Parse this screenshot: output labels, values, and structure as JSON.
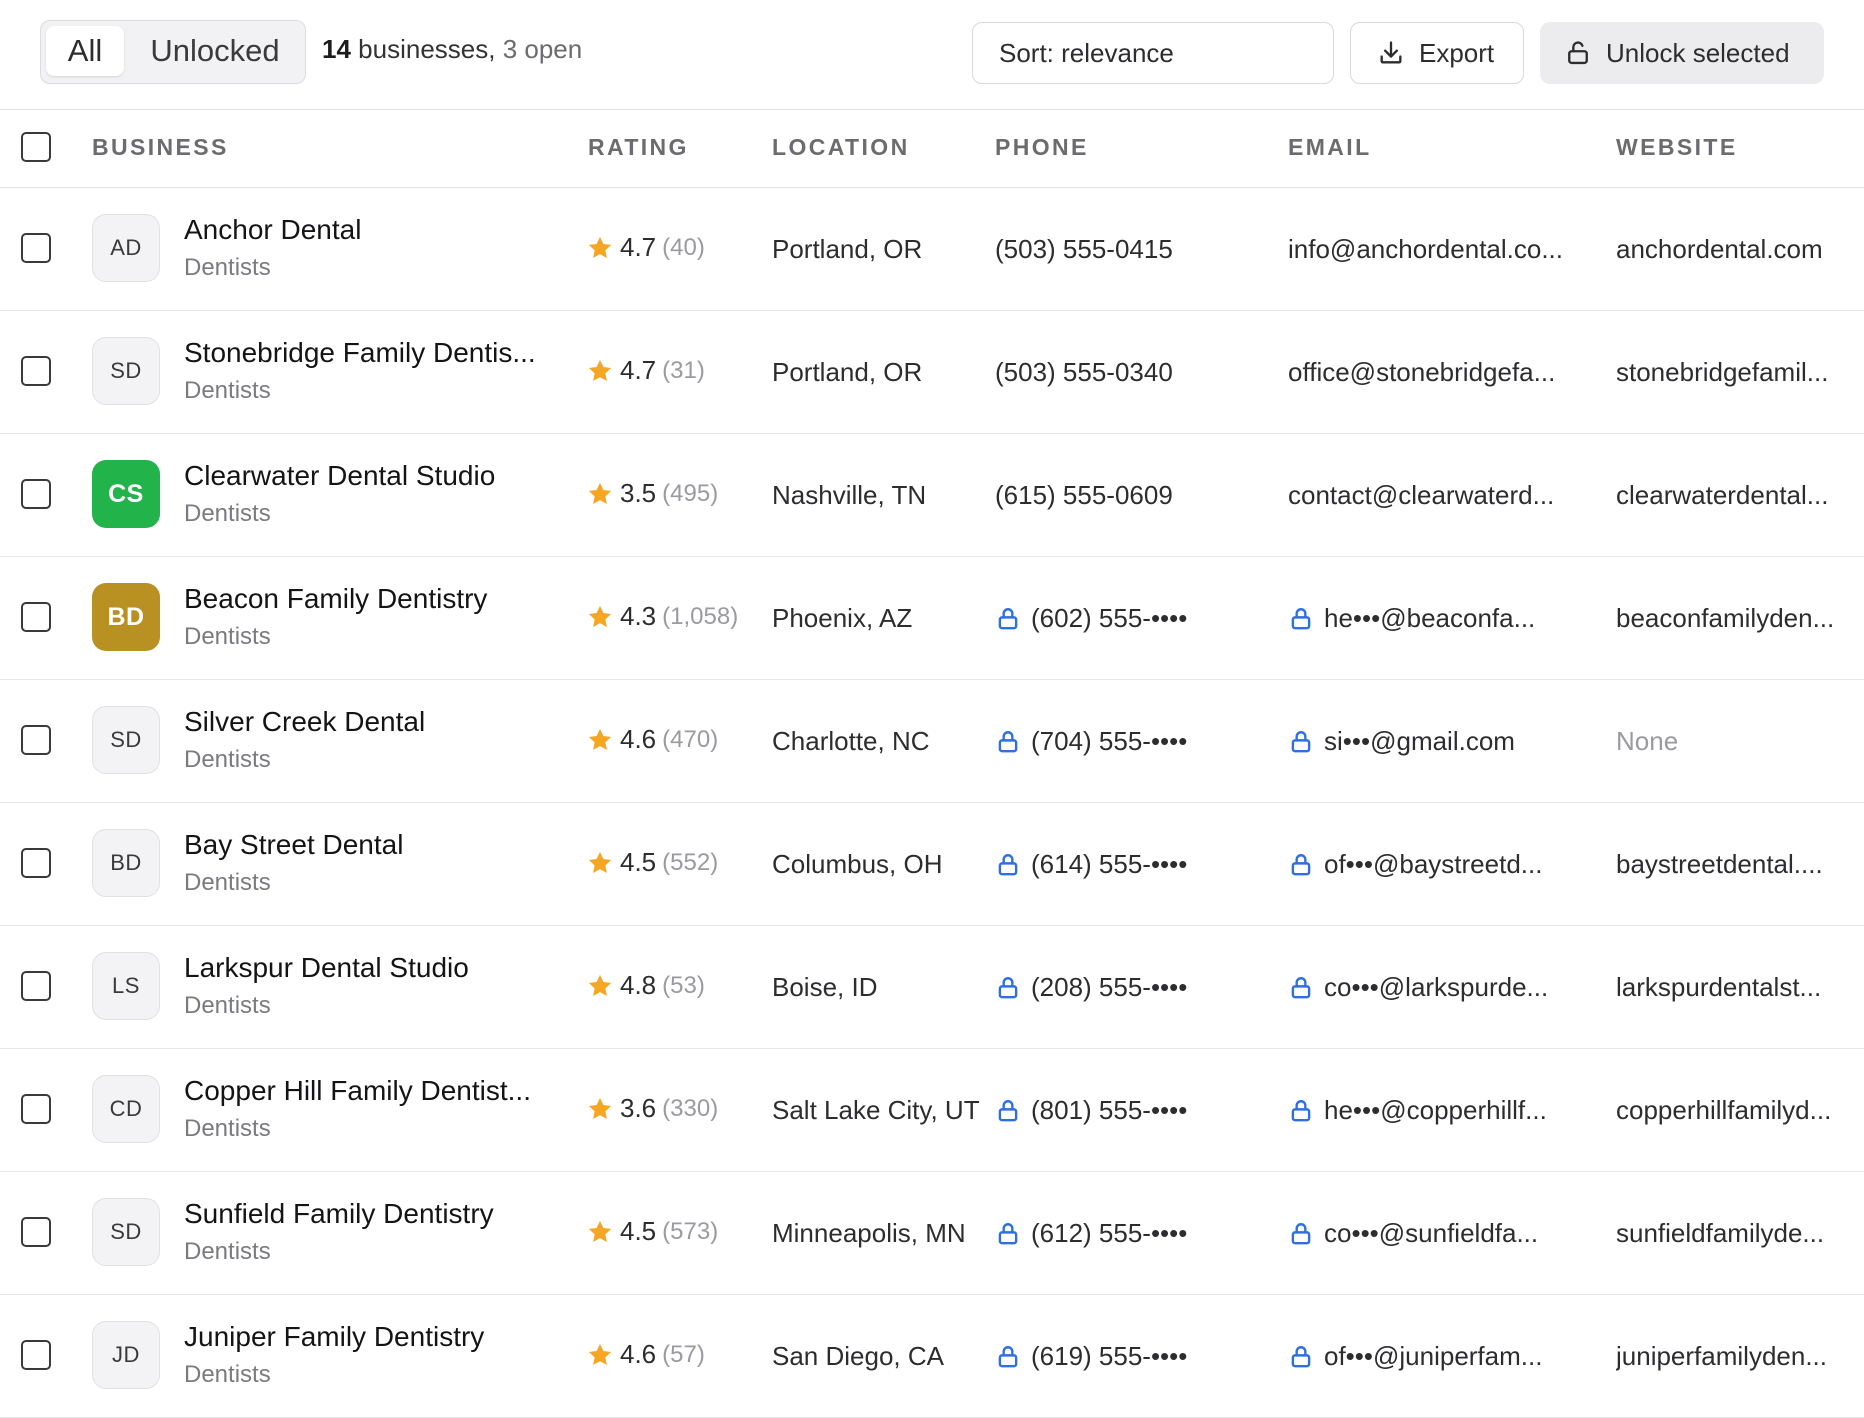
{
  "toolbar": {
    "filter_all": "All",
    "filter_unlocked": "Unlocked",
    "count": "14",
    "summary_mid": "businesses,",
    "summary_open": "3 open",
    "sort_label": "Sort: relevance",
    "export_label": "Export",
    "unlock_label": "Unlock selected"
  },
  "columns": {
    "business": "BUSINESS",
    "rating": "RATING",
    "location": "LOCATION",
    "phone": "PHONE",
    "email": "EMAIL",
    "website": "WEBSITE"
  },
  "rows": [
    {
      "initials": "AD",
      "avatar_style": "plain",
      "name": "Anchor Dental",
      "category": "Dentists",
      "rating": "4.7",
      "reviews": "(40)",
      "location": "Portland, OR",
      "phone": "(503) 555-0415",
      "phone_locked": false,
      "email": "info@anchordental.co...",
      "email_locked": false,
      "website": "anchordental.com"
    },
    {
      "initials": "SD",
      "avatar_style": "plain",
      "name": "Stonebridge Family Dentis...",
      "category": "Dentists",
      "rating": "4.7",
      "reviews": "(31)",
      "location": "Portland, OR",
      "phone": "(503) 555-0340",
      "phone_locked": false,
      "email": "office@stonebridgefa...",
      "email_locked": false,
      "website": "stonebridgefamil..."
    },
    {
      "initials": "CS",
      "avatar_style": "green",
      "name": "Clearwater Dental Studio",
      "category": "Dentists",
      "rating": "3.5",
      "reviews": "(495)",
      "location": "Nashville, TN",
      "phone": "(615) 555-0609",
      "phone_locked": false,
      "email": "contact@clearwaterd...",
      "email_locked": false,
      "website": "clearwaterdental..."
    },
    {
      "initials": "BD",
      "avatar_style": "gold",
      "name": "Beacon Family Dentistry",
      "category": "Dentists",
      "rating": "4.3",
      "reviews": "(1,058)",
      "location": "Phoenix, AZ",
      "phone": "(602) 555-••••",
      "phone_locked": true,
      "email": "he•••@beaconfa...",
      "email_locked": true,
      "website": "beaconfamilyden..."
    },
    {
      "initials": "SD",
      "avatar_style": "plain",
      "name": "Silver Creek Dental",
      "category": "Dentists",
      "rating": "4.6",
      "reviews": "(470)",
      "location": "Charlotte, NC",
      "phone": "(704) 555-••••",
      "phone_locked": true,
      "email": "si•••@gmail.com",
      "email_locked": true,
      "website": "None",
      "website_muted": true
    },
    {
      "initials": "BD",
      "avatar_style": "plain",
      "name": "Bay Street Dental",
      "category": "Dentists",
      "rating": "4.5",
      "reviews": "(552)",
      "location": "Columbus, OH",
      "phone": "(614) 555-••••",
      "phone_locked": true,
      "email": "of•••@baystreetd...",
      "email_locked": true,
      "website": "baystreetdental...."
    },
    {
      "initials": "LS",
      "avatar_style": "plain",
      "name": "Larkspur Dental Studio",
      "category": "Dentists",
      "rating": "4.8",
      "reviews": "(53)",
      "location": "Boise, ID",
      "phone": "(208) 555-••••",
      "phone_locked": true,
      "email": "co•••@larkspurde...",
      "email_locked": true,
      "website": "larkspurdentalst..."
    },
    {
      "initials": "CD",
      "avatar_style": "plain",
      "name": "Copper Hill Family Dentist...",
      "category": "Dentists",
      "rating": "3.6",
      "reviews": "(330)",
      "location": "Salt Lake City, UT",
      "phone": "(801) 555-••••",
      "phone_locked": true,
      "email": "he•••@copperhillf...",
      "email_locked": true,
      "website": "copperhillfamilyd..."
    },
    {
      "initials": "SD",
      "avatar_style": "plain",
      "name": "Sunfield Family Dentistry",
      "category": "Dentists",
      "rating": "4.5",
      "reviews": "(573)",
      "location": "Minneapolis, MN",
      "phone": "(612) 555-••••",
      "phone_locked": true,
      "email": "co•••@sunfieldfa...",
      "email_locked": true,
      "website": "sunfieldfamilyde..."
    },
    {
      "initials": "JD",
      "avatar_style": "plain",
      "name": "Juniper Family Dentistry",
      "category": "Dentists",
      "rating": "4.6",
      "reviews": "(57)",
      "location": "San Diego, CA",
      "phone": "(619) 555-••••",
      "phone_locked": true,
      "email": "of•••@juniperfam...",
      "email_locked": true,
      "website": "juniperfamilyden..."
    }
  ],
  "colors": {
    "star": "#f5a623",
    "lock": "#2f6fe4",
    "avatar_green": "#22b34a",
    "avatar_gold": "#b99122"
  },
  "icons": {
    "export": "download-icon",
    "unlock": "unlock-icon",
    "rating": "star-icon",
    "locked": "lock-icon"
  }
}
